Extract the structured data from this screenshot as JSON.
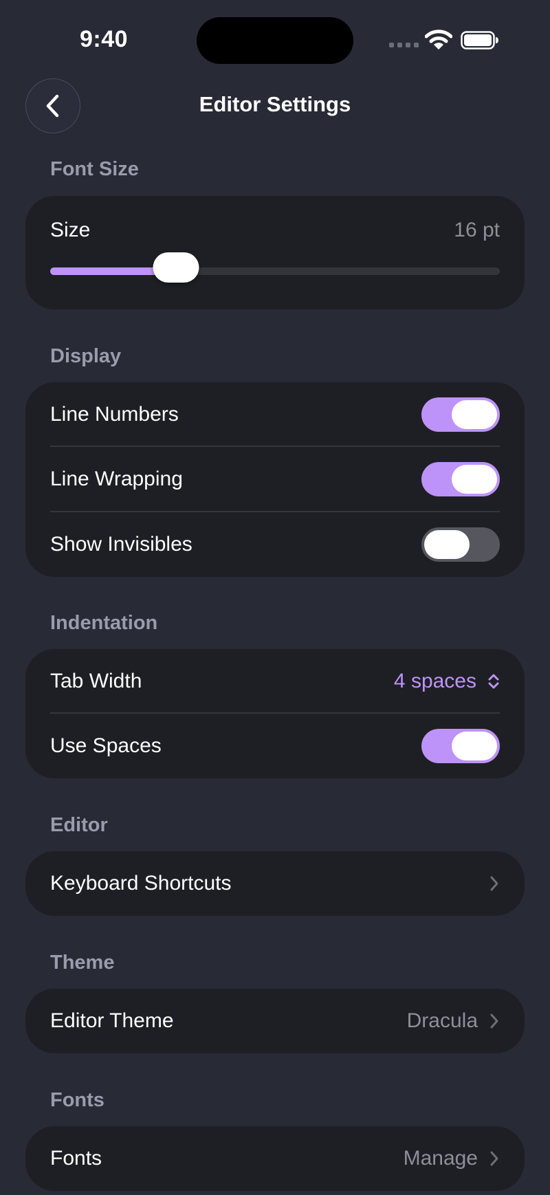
{
  "status_bar": {
    "time": "9:40"
  },
  "nav": {
    "title": "Editor Settings",
    "back_icon": "chevron-left-icon"
  },
  "font_size": {
    "header": "Font Size",
    "label": "Size",
    "value": "16 pt",
    "slider_fraction": 0.28
  },
  "display": {
    "header": "Display",
    "rows": [
      {
        "label": "Line Numbers",
        "on": true
      },
      {
        "label": "Line Wrapping",
        "on": true
      },
      {
        "label": "Show Invisibles",
        "on": false
      }
    ]
  },
  "indentation": {
    "header": "Indentation",
    "tab_width_label": "Tab Width",
    "tab_width_value": "4 spaces",
    "use_spaces_label": "Use Spaces",
    "use_spaces_on": true
  },
  "editor": {
    "header": "Editor",
    "shortcuts_label": "Keyboard Shortcuts"
  },
  "theme": {
    "header": "Theme",
    "label": "Editor Theme",
    "value": "Dracula"
  },
  "fonts": {
    "header": "Fonts",
    "label": "Fonts",
    "value": "Manage"
  },
  "colors": {
    "accent": "#bd93f9",
    "background": "#282a36",
    "card": "#1e1f24"
  }
}
